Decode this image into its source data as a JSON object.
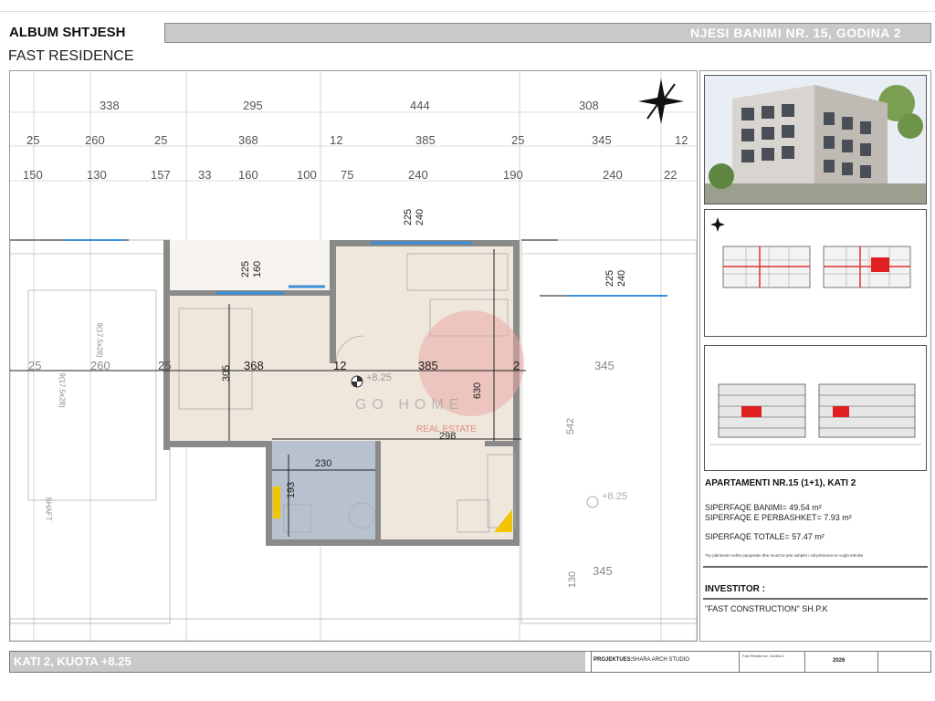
{
  "header": {
    "album_title": "ALBUM SHTJESH",
    "project_name": "FAST RESIDENCE",
    "unit_title": "NJESI BANIMI NR. 15, GODINA 2"
  },
  "plan": {
    "dims_row1": [
      "338",
      "295",
      "444",
      "308"
    ],
    "dims_row2": [
      "25",
      "260",
      "25",
      "368",
      "12",
      "385",
      "25",
      "345",
      "12"
    ],
    "dims_row3": [
      "150",
      "130",
      "157",
      "33",
      "160",
      "100",
      "75",
      "240",
      "190",
      "240",
      "22"
    ],
    "left_dims": [
      "25",
      "260",
      "25"
    ],
    "room_dims": [
      "368",
      "12",
      "385",
      "2"
    ],
    "right_dim": "345",
    "window_top": [
      "240",
      "225"
    ],
    "window_left": [
      "160",
      "225"
    ],
    "window_right": [
      "240",
      "225"
    ],
    "height_305": "305",
    "height_630": "630",
    "height_542": "542",
    "height_193": "193",
    "height_130": "130",
    "width_230": "230",
    "width_298": "298",
    "bottom_dim": "345",
    "level": "+8.25",
    "level_right": "+8.25",
    "stairs_label_1": "9(17.5x28)",
    "stairs_label_2": "9(17.5x28)",
    "shaft_label": "SHAFT",
    "watermark_text": "GO HOME",
    "watermark_sub": "REAL ESTATE",
    "colors": {
      "apartment_fill": "#efe7dc",
      "bath_fill": "#b8c2cf",
      "wall": "#8a8a8a",
      "window": "#3a8fd8",
      "dimension_line": "#222222"
    }
  },
  "right_panel": {
    "apartment_title": "APARTAMENTI NR.15 (1+1), KATI 2",
    "living_area": "SIPERFAQE BANIMI=  49.54 m²",
    "common_area": "SIPERFAQE E PERBASHKET=  7.93 m²",
    "total_area": "SIPERFAQE TOTALE=  57.47 m²",
    "note": "*Ky planimetri eshte paraprake dhe mund te jete subjekt i ndryshimeve te vogla teknike",
    "investor_label": "INVESTITOR :",
    "investor_name": "\"FAST CONSTRUCTION\" SH.P.K"
  },
  "footer": {
    "floor": "KATI 2, KUOTA +8.25",
    "project_label": "PROJEKTUES:",
    "designer": "SHARA ARCH STUDIO",
    "small_note": "Fast Residence, Godina 2",
    "year": "2026"
  }
}
